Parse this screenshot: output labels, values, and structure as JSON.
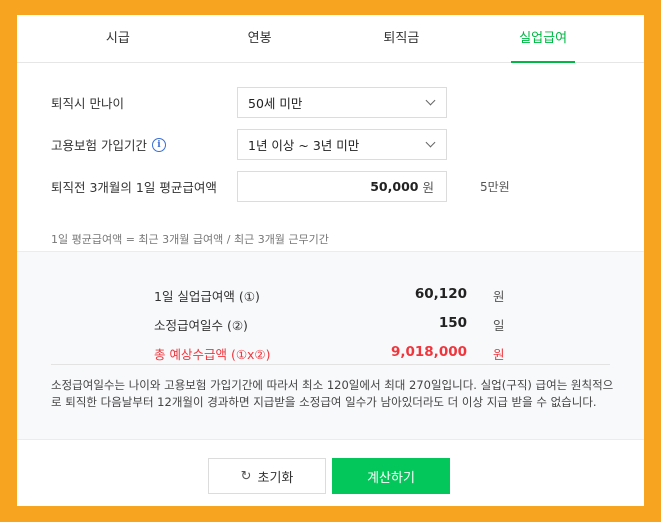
{
  "tabs": [
    {
      "label": "시급"
    },
    {
      "label": "연봉"
    },
    {
      "label": "퇴직금"
    },
    {
      "label": "실업급여"
    }
  ],
  "form": {
    "age": {
      "label": "퇴직시 만나이",
      "value": "50세 미만"
    },
    "insurance": {
      "label": "고용보험 가입기간",
      "info_icon": "i",
      "value": "1년 이상 ~ 3년 미만"
    },
    "wage": {
      "label": "퇴직전 3개월의 1일 평균급여액",
      "value": "50,000",
      "unit": "원",
      "helper": "5만원"
    },
    "formula": "1일 평균급여액 = 최근 3개월 급여액 / 최근 3개월 근무기간"
  },
  "result": {
    "daily": {
      "label": "1일 실업급여액 (①)",
      "value": "60,120",
      "unit": "원"
    },
    "days": {
      "label": "소정급여일수 (②)",
      "value": "150",
      "unit": "일"
    },
    "total": {
      "label": "총 예상수급액 (①x②)",
      "value": "9,018,000",
      "unit": "원"
    },
    "note": "소정급여일수는 나이와 고용보험 가입기간에 따라서 최소 120일에서 최대 270일입니다. 실업(구직) 급여는 원칙적으로 퇴직한 다음날부터 12개월이 경과하면 지급받을 소정급여 일수가 남아있더라도 더 이상 지급 받을 수 없습니다."
  },
  "buttons": {
    "reset": "초기화",
    "reset_icon": "↻",
    "calculate": "계산하기"
  },
  "colors": {
    "background": "#f7a521",
    "accent": "#00b843",
    "button": "#03c75a",
    "total": "#f0363d"
  }
}
